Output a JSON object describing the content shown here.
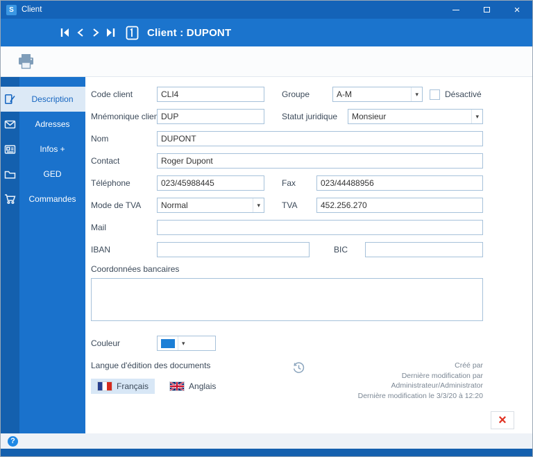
{
  "window": {
    "title": "Client",
    "app_initial": "S",
    "close_glyph": "×"
  },
  "header": {
    "title": "Client : DUPONT"
  },
  "sidebar": {
    "items": [
      {
        "label": "Description",
        "selected": true
      },
      {
        "label": "Adresses",
        "selected": false
      },
      {
        "label": "Infos +",
        "selected": false
      },
      {
        "label": "GED",
        "selected": false
      },
      {
        "label": "Commandes",
        "selected": false
      }
    ]
  },
  "form": {
    "code_client": {
      "label": "Code client",
      "value": "CLI4"
    },
    "groupe": {
      "label": "Groupe",
      "value": "A-M"
    },
    "desactive": {
      "label": "Désactivé",
      "checked": false
    },
    "mnemonique": {
      "label": "Mnémonique client",
      "value": "DUP"
    },
    "statut": {
      "label": "Statut juridique",
      "value": "Monsieur"
    },
    "nom": {
      "label": "Nom",
      "value": "DUPONT"
    },
    "contact": {
      "label": "Contact",
      "value": "Roger Dupont"
    },
    "telephone": {
      "label": "Téléphone",
      "value": "023/45988445"
    },
    "fax": {
      "label": "Fax",
      "value": "023/44488956"
    },
    "mode_tva": {
      "label": "Mode de TVA",
      "value": "Normal"
    },
    "tva": {
      "label": "TVA",
      "value": "452.256.270"
    },
    "mail": {
      "label": "Mail",
      "value": ""
    },
    "iban": {
      "label": "IBAN",
      "value": ""
    },
    "bic": {
      "label": "BIC",
      "value": ""
    },
    "coordonnees": {
      "label": "Coordonnées bancaires",
      "value": ""
    },
    "couleur": {
      "label": "Couleur",
      "swatch_color": "#1c7fd6"
    },
    "langue": {
      "label": "Langue d'édition des documents",
      "options": [
        {
          "label": "Français",
          "selected": true
        },
        {
          "label": "Anglais",
          "selected": false
        }
      ]
    }
  },
  "meta": {
    "line1": "Créé par",
    "line2": "Dernière modification par Administrateur/Administrator",
    "line3": "Dernière modification le 3/3/20 à 12:20"
  },
  "footer": {
    "help": "?",
    "close": "×"
  },
  "icons": {
    "app_logo": "app-logo-icon",
    "nav": [
      "first-record-icon",
      "previous-record-icon",
      "next-record-icon",
      "last-record-icon"
    ],
    "record": "record-card-icon",
    "print": "printer-icon",
    "sidebar": [
      "description-page-icon",
      "addresses-envelope-icon",
      "info-card-icon",
      "folder-icon",
      "cart-icon"
    ],
    "history": "history-clock-icon",
    "help": "help-icon",
    "close_red": "close-icon"
  },
  "colors": {
    "titlebar": "#1463b8",
    "header": "#1b74cd",
    "sidebar_dark": "#1460ae",
    "sidebar": "#1a72cc",
    "selected_tab_bg": "#dce9f6",
    "accent": "#1565c0",
    "swatch": "#1c7fd6",
    "close_red": "#e03222"
  }
}
